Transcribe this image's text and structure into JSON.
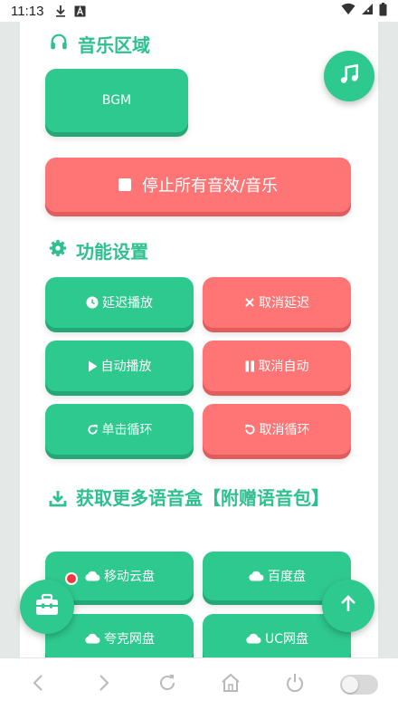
{
  "status_bar": {
    "time": "11:13",
    "icons": [
      "download-icon",
      "font-app-icon",
      "wifi-icon",
      "signal-icon",
      "battery-icon"
    ]
  },
  "sections": {
    "music": {
      "title": "音乐区域",
      "icon": "headphones-icon"
    },
    "settings": {
      "title": "功能设置",
      "icon": "gear-icon"
    },
    "download": {
      "title": "获取更多语音盒【附赠语音包】",
      "icon": "download-icon"
    }
  },
  "buttons": {
    "bgm": "BGM",
    "stop_all": "停止所有音效/音乐",
    "delay_play": "延迟播放",
    "cancel_delay": "取消延迟",
    "auto_play": "自动播放",
    "cancel_auto": "取消自动",
    "single_loop": "单击循环",
    "cancel_loop": "取消循环",
    "mobile_cloud": "移动云盘",
    "baidu_pan": "百度盘",
    "quark_pan": "夸克网盘",
    "uc_pan": "UC网盘"
  },
  "colors": {
    "accent_green": "#2ec98e",
    "accent_red": "#ff7474",
    "title_green": "#2ec08e",
    "badge_red": "#f0383e"
  },
  "floating": {
    "music_note": "music-note-icon",
    "toolbox": "toolbox-icon",
    "scroll_top": "arrow-up-icon"
  },
  "navbar": {
    "icons": [
      "back-icon",
      "forward-icon",
      "refresh-icon",
      "home-icon",
      "power-icon",
      "toggle-switch"
    ]
  }
}
